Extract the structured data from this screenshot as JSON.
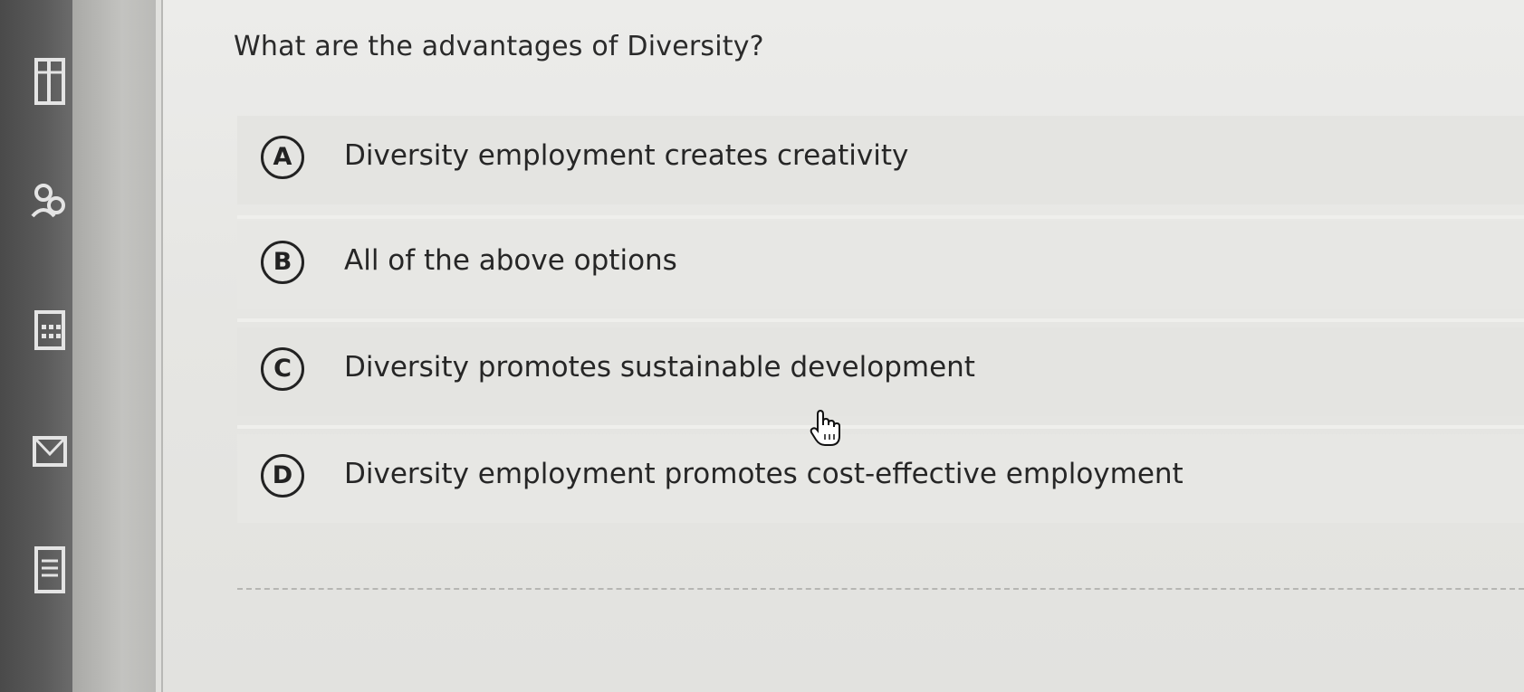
{
  "question": {
    "text": "What are the advantages of Diversity?"
  },
  "options": [
    {
      "letter": "A",
      "text": "Diversity employment creates creativity"
    },
    {
      "letter": "B",
      "text": "All of the above options"
    },
    {
      "letter": "C",
      "text": "Diversity promotes sustainable development"
    },
    {
      "letter": "D",
      "text": "Diversity employment promotes cost-effective employment"
    }
  ],
  "sidebar": {
    "icons": [
      "columns-icon",
      "people-icon",
      "calendar-icon",
      "mail-icon",
      "document-icon"
    ]
  },
  "colors": {
    "page_background": "#e8e8e5",
    "text": "#262626",
    "sidebar": "#4a4a4a"
  }
}
